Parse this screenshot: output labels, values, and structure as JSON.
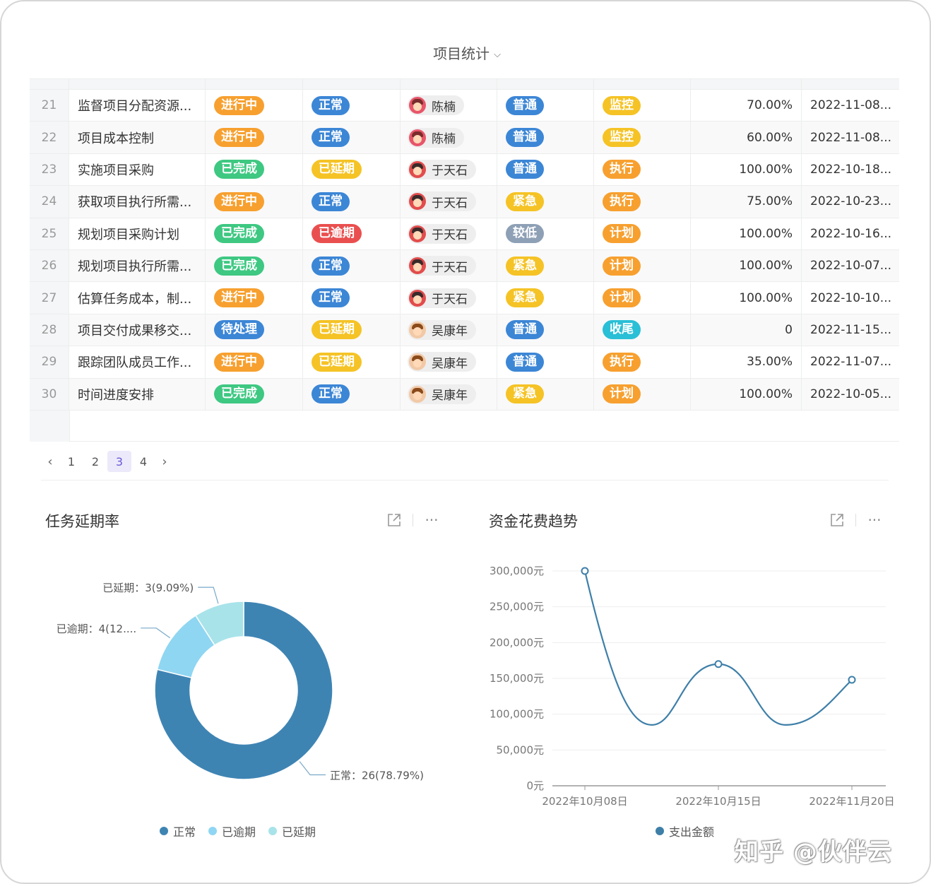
{
  "page": {
    "title": "项目统计"
  },
  "colors": {
    "orange": "#f7a02f",
    "blue": "#3c86d6",
    "green": "#3ec882",
    "yellow": "#f5c325",
    "red": "#ea4f4f",
    "slate": "#8ea0b5",
    "teal": "#29bfd6",
    "dark": "#ffd600"
  },
  "table": {
    "rows": [
      {
        "no": "21",
        "name": "监督项目分配资源...",
        "status": "进行中",
        "status_color": "orange",
        "health": "正常",
        "health_color": "blue",
        "owner": "陈楠",
        "avatar": "female",
        "priority": "普通",
        "priority_color": "blue",
        "phase": "监控",
        "phase_color": "yellow",
        "progress": "70.00%",
        "date": "2022-11-08..."
      },
      {
        "no": "22",
        "name": "项目成本控制",
        "status": "进行中",
        "status_color": "orange",
        "health": "正常",
        "health_color": "blue",
        "owner": "陈楠",
        "avatar": "female",
        "priority": "普通",
        "priority_color": "blue",
        "phase": "监控",
        "phase_color": "yellow",
        "progress": "60.00%",
        "date": "2022-11-08..."
      },
      {
        "no": "23",
        "name": "实施项目采购",
        "status": "已完成",
        "status_color": "green",
        "health": "已延期",
        "health_color": "yellow",
        "owner": "于天石",
        "avatar": "male-red",
        "priority": "普通",
        "priority_color": "blue",
        "phase": "执行",
        "phase_color": "orange",
        "progress": "100.00%",
        "date": "2022-10-18..."
      },
      {
        "no": "24",
        "name": "获取项目执行所需...",
        "status": "进行中",
        "status_color": "orange",
        "health": "正常",
        "health_color": "blue",
        "owner": "于天石",
        "avatar": "male-red",
        "priority": "紧急",
        "priority_color": "yellow",
        "phase": "执行",
        "phase_color": "orange",
        "progress": "75.00%",
        "date": "2022-10-23..."
      },
      {
        "no": "25",
        "name": "规划项目采购计划",
        "status": "已完成",
        "status_color": "green",
        "health": "已逾期",
        "health_color": "red",
        "owner": "于天石",
        "avatar": "male-red",
        "priority": "较低",
        "priority_color": "slate",
        "phase": "计划",
        "phase_color": "orange",
        "progress": "100.00%",
        "date": "2022-10-16..."
      },
      {
        "no": "26",
        "name": "规划项目执行所需...",
        "status": "已完成",
        "status_color": "green",
        "health": "正常",
        "health_color": "blue",
        "owner": "于天石",
        "avatar": "male-red",
        "priority": "紧急",
        "priority_color": "yellow",
        "phase": "计划",
        "phase_color": "orange",
        "progress": "100.00%",
        "date": "2022-10-07..."
      },
      {
        "no": "27",
        "name": "估算任务成本，制...",
        "status": "进行中",
        "status_color": "orange",
        "health": "正常",
        "health_color": "blue",
        "owner": "于天石",
        "avatar": "male-red",
        "priority": "紧急",
        "priority_color": "yellow",
        "phase": "计划",
        "phase_color": "orange",
        "progress": "100.00%",
        "date": "2022-10-10..."
      },
      {
        "no": "28",
        "name": "项目交付成果移交...",
        "status": "待处理",
        "status_color": "blue",
        "health": "已延期",
        "health_color": "yellow",
        "owner": "吴康年",
        "avatar": "male-brown",
        "priority": "普通",
        "priority_color": "blue",
        "phase": "收尾",
        "phase_color": "teal",
        "progress": "0",
        "date": "2022-11-15..."
      },
      {
        "no": "29",
        "name": "跟踪团队成员工作...",
        "status": "进行中",
        "status_color": "orange",
        "health": "已延期",
        "health_color": "yellow",
        "owner": "吴康年",
        "avatar": "male-brown",
        "priority": "普通",
        "priority_color": "blue",
        "phase": "执行",
        "phase_color": "orange",
        "progress": "35.00%",
        "date": "2022-11-07..."
      },
      {
        "no": "30",
        "name": "时间进度安排",
        "status": "已完成",
        "status_color": "green",
        "health": "正常",
        "health_color": "blue",
        "owner": "吴康年",
        "avatar": "male-brown",
        "priority": "紧急",
        "priority_color": "yellow",
        "phase": "计划",
        "phase_color": "orange",
        "progress": "100.00%",
        "date": "2022-10-05..."
      }
    ]
  },
  "pagination": {
    "prev": "<",
    "next": ">",
    "pages": [
      "1",
      "2",
      "3",
      "4"
    ],
    "current": "3"
  },
  "panels": {
    "delay": {
      "title": "任务延期率",
      "expand_icon": "external-link-icon",
      "more_label": "···"
    },
    "cost": {
      "title": "资金花费趋势",
      "expand_icon": "external-link-icon",
      "more_label": "···"
    }
  },
  "chart_data": [
    {
      "type": "pie",
      "title": "任务延期率",
      "style": "donut",
      "slices": [
        {
          "name": "正常",
          "value": 26,
          "label": "正常：26(78.79%)",
          "color": "#3e84b3"
        },
        {
          "name": "已逾期",
          "value": 4,
          "label": "已逾期：4(12....",
          "color": "#8fd6f2"
        },
        {
          "name": "已延期",
          "value": 3,
          "label": "已延期：3(9.09%)",
          "color": "#a8e3ea"
        }
      ],
      "legend": [
        "正常",
        "已逾期",
        "已延期"
      ],
      "legend_position": "bottom"
    },
    {
      "type": "line",
      "title": "资金花费趋势",
      "smooth": true,
      "categories": [
        "2022年10月08日",
        "2022年10月15日",
        "2022年11月20日"
      ],
      "series": [
        {
          "name": "支出金额",
          "values": [
            300000,
            170000,
            148000
          ],
          "color": "#3e7fa8"
        }
      ],
      "ylim": [
        0,
        300000
      ],
      "yticks": [
        "300,000元",
        "250,000元",
        "200,000元",
        "150,000元",
        "100,000元",
        "50,000元",
        "0元"
      ],
      "grid": true,
      "legend_position": "bottom"
    }
  ],
  "watermark": "知乎 @伙伴云"
}
